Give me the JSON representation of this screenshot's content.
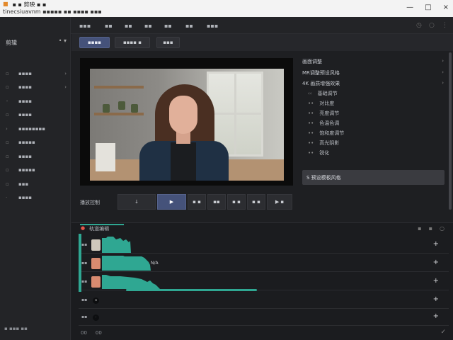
{
  "titlebar": {
    "app_title": "▪ ▪ 剪映 ▪ ▪",
    "path": "tinecsiuavnm  ▪▪▪▪▪  ▪▪ ▪▪▪▪ ▪▪▪",
    "window_controls": [
      "—",
      "□",
      "×"
    ]
  },
  "sidebar": {
    "header": "剪辑",
    "items": [
      {
        "label": "▪▪▪▪"
      },
      {
        "label": "▪▪▪▪"
      },
      {
        "label": "▪▪▪▪"
      },
      {
        "label": "▪▪▪▪"
      },
      {
        "label": "▪▪▪▪▪▪▪▪"
      },
      {
        "label": "▪▪▪▪▪"
      },
      {
        "label": "▪▪▪▪"
      },
      {
        "label": "▪▪▪▪▪"
      },
      {
        "label": "▪▪▪"
      },
      {
        "label": "▪▪▪▪"
      }
    ],
    "footer": "▪ ▪▪▪ ▪▪"
  },
  "topnav": {
    "tabs": [
      "剪辑",
      "▪▪",
      "▪▪",
      "▪▪▪",
      "▪▪▪",
      "▪▪",
      "▪▪",
      "▪▪",
      "▪▪",
      "▪▪",
      "▪▪▪"
    ]
  },
  "subbar": {
    "buttons": [
      "▪▪▪▪",
      "▪▪▪▪ ▪",
      "▪▪▪"
    ]
  },
  "inspector": {
    "rows": [
      "画面调整",
      "MR调整预设风格",
      "4K 画质增强效果"
    ],
    "tree": [
      "基础调节",
      "对比度",
      "亮度调节",
      "色温色调",
      "饱和度调节",
      "高光阴影",
      "锐化"
    ],
    "preset_label": "S 预设模板风格"
  },
  "transport": {
    "label": "播放控制",
    "buttons": [
      "↓",
      "▶",
      "▪ ▪",
      "▪▪",
      "▪ ▪",
      "▪ ▪",
      "▶ ▪"
    ]
  },
  "timeline": {
    "header": "轨道编辑",
    "controls": [
      "▪",
      "▪",
      "○"
    ],
    "tracks": [
      {
        "name": "▪▪",
        "clip_label": ""
      },
      {
        "name": "▪▪",
        "clip_label": "N/A"
      },
      {
        "name": "▪▪",
        "clip_label": ""
      },
      {
        "name": "▪▪",
        "clip_label": ""
      },
      {
        "name": "▪▪",
        "clip_label": ""
      }
    ],
    "footer": [
      "00",
      "00"
    ]
  }
}
